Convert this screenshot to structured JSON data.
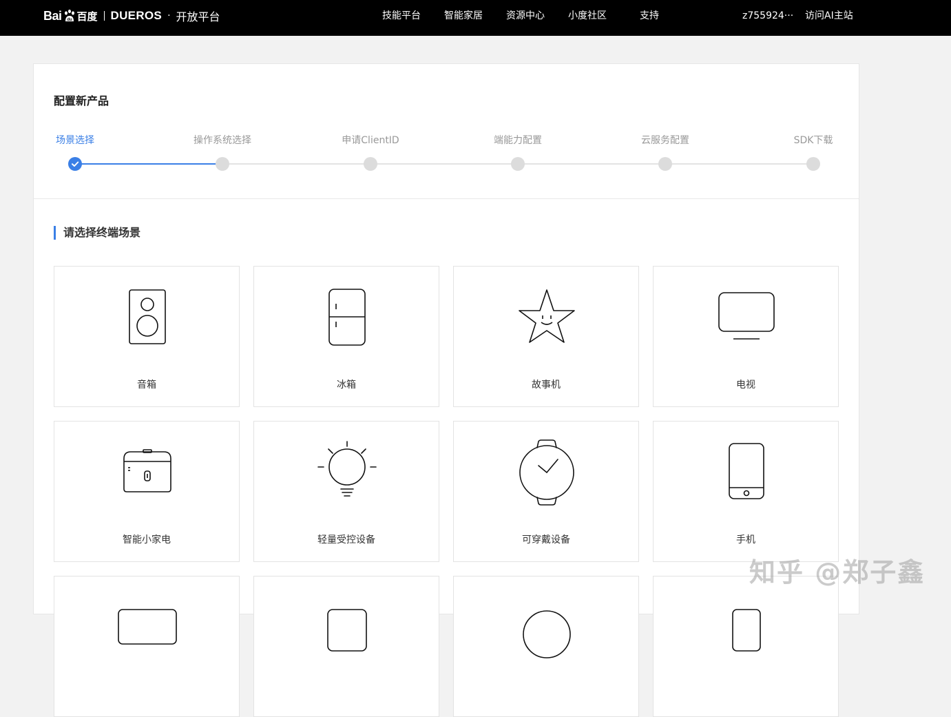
{
  "header": {
    "logo_baidu_latin": "Bai",
    "logo_baidu_cn": "百度",
    "logo_dueros": "DUEROS",
    "logo_dot": "·",
    "logo_open": "开放平台",
    "nav": [
      "技能平台",
      "智能家居",
      "资源中心",
      "小度社区",
      "支持"
    ],
    "username": "z755924···",
    "visit_ai": "访问AI主站"
  },
  "card": {
    "title": "配置新产品",
    "steps": [
      {
        "label": "场景选择",
        "status": "active"
      },
      {
        "label": "操作系统选择",
        "status": "pending"
      },
      {
        "label": "申请ClientID",
        "status": "pending"
      },
      {
        "label": "端能力配置",
        "status": "pending"
      },
      {
        "label": "云服务配置",
        "status": "pending"
      },
      {
        "label": "SDK下载",
        "status": "pending"
      }
    ],
    "section_title": "请选择终端场景",
    "scenes": [
      {
        "label": "音箱",
        "icon": "speaker-icon"
      },
      {
        "label": "冰箱",
        "icon": "fridge-icon"
      },
      {
        "label": "故事机",
        "icon": "star-icon"
      },
      {
        "label": "电视",
        "icon": "tv-icon"
      },
      {
        "label": "智能小家电",
        "icon": "rice-cooker-icon"
      },
      {
        "label": "轻量受控设备",
        "icon": "lightbulb-icon"
      },
      {
        "label": "可穿戴设备",
        "icon": "watch-icon"
      },
      {
        "label": "手机",
        "icon": "phone-icon"
      }
    ]
  },
  "watermark": "知乎 @郑子鑫",
  "colors": {
    "accent": "#3a7fe6",
    "topbar": "#000000",
    "background": "#f2f2f2"
  }
}
